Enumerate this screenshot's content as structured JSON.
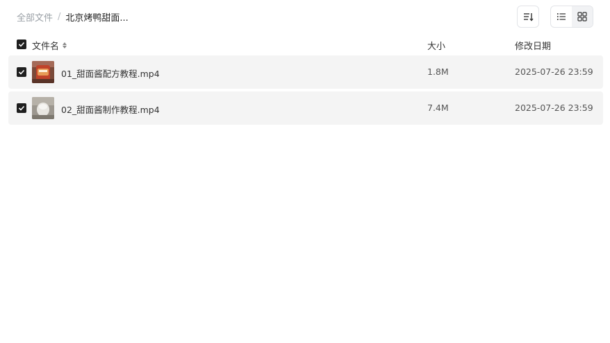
{
  "breadcrumb": {
    "root": "全部文件",
    "separator": "/",
    "current": "北京烤鸭甜面..."
  },
  "toolbar": {
    "sort_icon": "sort-icon",
    "view_modes": [
      "list-view-icon",
      "grid-view-icon"
    ],
    "active_view": "list"
  },
  "table": {
    "columns": {
      "name": "文件名",
      "size": "大小",
      "date": "修改日期"
    },
    "select_all_checked": true,
    "rows": [
      {
        "name": "01_甜面酱配方教程.mp4",
        "size": "1.8M",
        "date": "2025-07-26 23:59",
        "checked": true
      },
      {
        "name": "02_甜面酱制作教程.mp4",
        "size": "7.4M",
        "date": "2025-07-26 23:59",
        "checked": true
      }
    ]
  }
}
